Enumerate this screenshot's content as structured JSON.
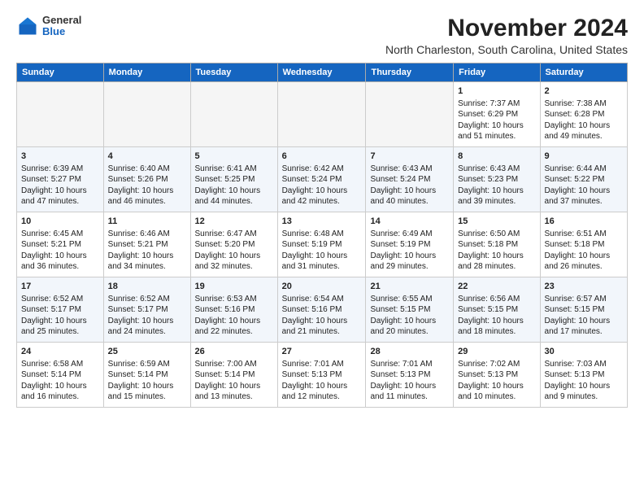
{
  "logo": {
    "general": "General",
    "blue": "Blue"
  },
  "header": {
    "title": "November 2024",
    "subtitle": "North Charleston, South Carolina, United States"
  },
  "weekdays": [
    "Sunday",
    "Monday",
    "Tuesday",
    "Wednesday",
    "Thursday",
    "Friday",
    "Saturday"
  ],
  "weeks": [
    [
      {
        "day": "",
        "info": ""
      },
      {
        "day": "",
        "info": ""
      },
      {
        "day": "",
        "info": ""
      },
      {
        "day": "",
        "info": ""
      },
      {
        "day": "",
        "info": ""
      },
      {
        "day": "1",
        "info": "Sunrise: 7:37 AM\nSunset: 6:29 PM\nDaylight: 10 hours\nand 51 minutes."
      },
      {
        "day": "2",
        "info": "Sunrise: 7:38 AM\nSunset: 6:28 PM\nDaylight: 10 hours\nand 49 minutes."
      }
    ],
    [
      {
        "day": "3",
        "info": "Sunrise: 6:39 AM\nSunset: 5:27 PM\nDaylight: 10 hours\nand 47 minutes."
      },
      {
        "day": "4",
        "info": "Sunrise: 6:40 AM\nSunset: 5:26 PM\nDaylight: 10 hours\nand 46 minutes."
      },
      {
        "day": "5",
        "info": "Sunrise: 6:41 AM\nSunset: 5:25 PM\nDaylight: 10 hours\nand 44 minutes."
      },
      {
        "day": "6",
        "info": "Sunrise: 6:42 AM\nSunset: 5:24 PM\nDaylight: 10 hours\nand 42 minutes."
      },
      {
        "day": "7",
        "info": "Sunrise: 6:43 AM\nSunset: 5:24 PM\nDaylight: 10 hours\nand 40 minutes."
      },
      {
        "day": "8",
        "info": "Sunrise: 6:43 AM\nSunset: 5:23 PM\nDaylight: 10 hours\nand 39 minutes."
      },
      {
        "day": "9",
        "info": "Sunrise: 6:44 AM\nSunset: 5:22 PM\nDaylight: 10 hours\nand 37 minutes."
      }
    ],
    [
      {
        "day": "10",
        "info": "Sunrise: 6:45 AM\nSunset: 5:21 PM\nDaylight: 10 hours\nand 36 minutes."
      },
      {
        "day": "11",
        "info": "Sunrise: 6:46 AM\nSunset: 5:21 PM\nDaylight: 10 hours\nand 34 minutes."
      },
      {
        "day": "12",
        "info": "Sunrise: 6:47 AM\nSunset: 5:20 PM\nDaylight: 10 hours\nand 32 minutes."
      },
      {
        "day": "13",
        "info": "Sunrise: 6:48 AM\nSunset: 5:19 PM\nDaylight: 10 hours\nand 31 minutes."
      },
      {
        "day": "14",
        "info": "Sunrise: 6:49 AM\nSunset: 5:19 PM\nDaylight: 10 hours\nand 29 minutes."
      },
      {
        "day": "15",
        "info": "Sunrise: 6:50 AM\nSunset: 5:18 PM\nDaylight: 10 hours\nand 28 minutes."
      },
      {
        "day": "16",
        "info": "Sunrise: 6:51 AM\nSunset: 5:18 PM\nDaylight: 10 hours\nand 26 minutes."
      }
    ],
    [
      {
        "day": "17",
        "info": "Sunrise: 6:52 AM\nSunset: 5:17 PM\nDaylight: 10 hours\nand 25 minutes."
      },
      {
        "day": "18",
        "info": "Sunrise: 6:52 AM\nSunset: 5:17 PM\nDaylight: 10 hours\nand 24 minutes."
      },
      {
        "day": "19",
        "info": "Sunrise: 6:53 AM\nSunset: 5:16 PM\nDaylight: 10 hours\nand 22 minutes."
      },
      {
        "day": "20",
        "info": "Sunrise: 6:54 AM\nSunset: 5:16 PM\nDaylight: 10 hours\nand 21 minutes."
      },
      {
        "day": "21",
        "info": "Sunrise: 6:55 AM\nSunset: 5:15 PM\nDaylight: 10 hours\nand 20 minutes."
      },
      {
        "day": "22",
        "info": "Sunrise: 6:56 AM\nSunset: 5:15 PM\nDaylight: 10 hours\nand 18 minutes."
      },
      {
        "day": "23",
        "info": "Sunrise: 6:57 AM\nSunset: 5:15 PM\nDaylight: 10 hours\nand 17 minutes."
      }
    ],
    [
      {
        "day": "24",
        "info": "Sunrise: 6:58 AM\nSunset: 5:14 PM\nDaylight: 10 hours\nand 16 minutes."
      },
      {
        "day": "25",
        "info": "Sunrise: 6:59 AM\nSunset: 5:14 PM\nDaylight: 10 hours\nand 15 minutes."
      },
      {
        "day": "26",
        "info": "Sunrise: 7:00 AM\nSunset: 5:14 PM\nDaylight: 10 hours\nand 13 minutes."
      },
      {
        "day": "27",
        "info": "Sunrise: 7:01 AM\nSunset: 5:13 PM\nDaylight: 10 hours\nand 12 minutes."
      },
      {
        "day": "28",
        "info": "Sunrise: 7:01 AM\nSunset: 5:13 PM\nDaylight: 10 hours\nand 11 minutes."
      },
      {
        "day": "29",
        "info": "Sunrise: 7:02 AM\nSunset: 5:13 PM\nDaylight: 10 hours\nand 10 minutes."
      },
      {
        "day": "30",
        "info": "Sunrise: 7:03 AM\nSunset: 5:13 PM\nDaylight: 10 hours\nand 9 minutes."
      }
    ]
  ]
}
